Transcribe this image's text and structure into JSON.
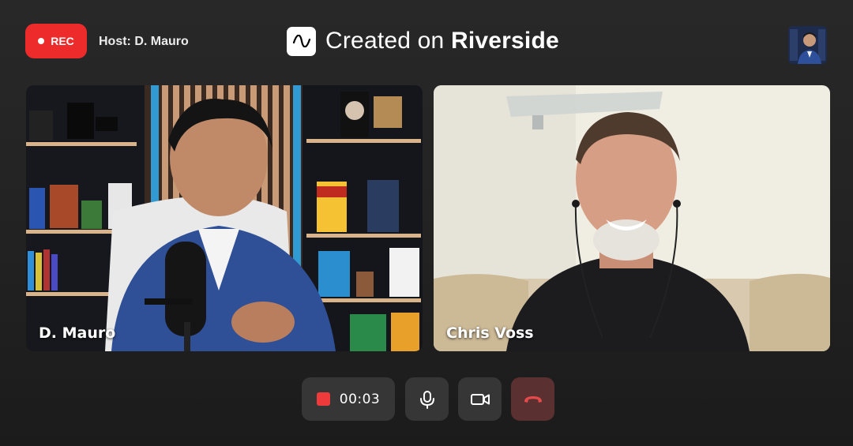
{
  "header": {
    "rec_label": "REC",
    "host_label": "Host: D. Mauro",
    "brand_prefix": "Created on",
    "brand_name": "Riverside"
  },
  "participants": [
    {
      "name": "D. Mauro"
    },
    {
      "name": "Chris Voss"
    }
  ],
  "controls": {
    "timer": "00:03",
    "mic_icon": "microphone-icon",
    "camera_icon": "video-camera-icon",
    "end_icon": "phone-hangup-icon"
  },
  "colors": {
    "rec": "#ee2b2b",
    "end_call": "#e54a4a",
    "control_bg": "#363636"
  }
}
